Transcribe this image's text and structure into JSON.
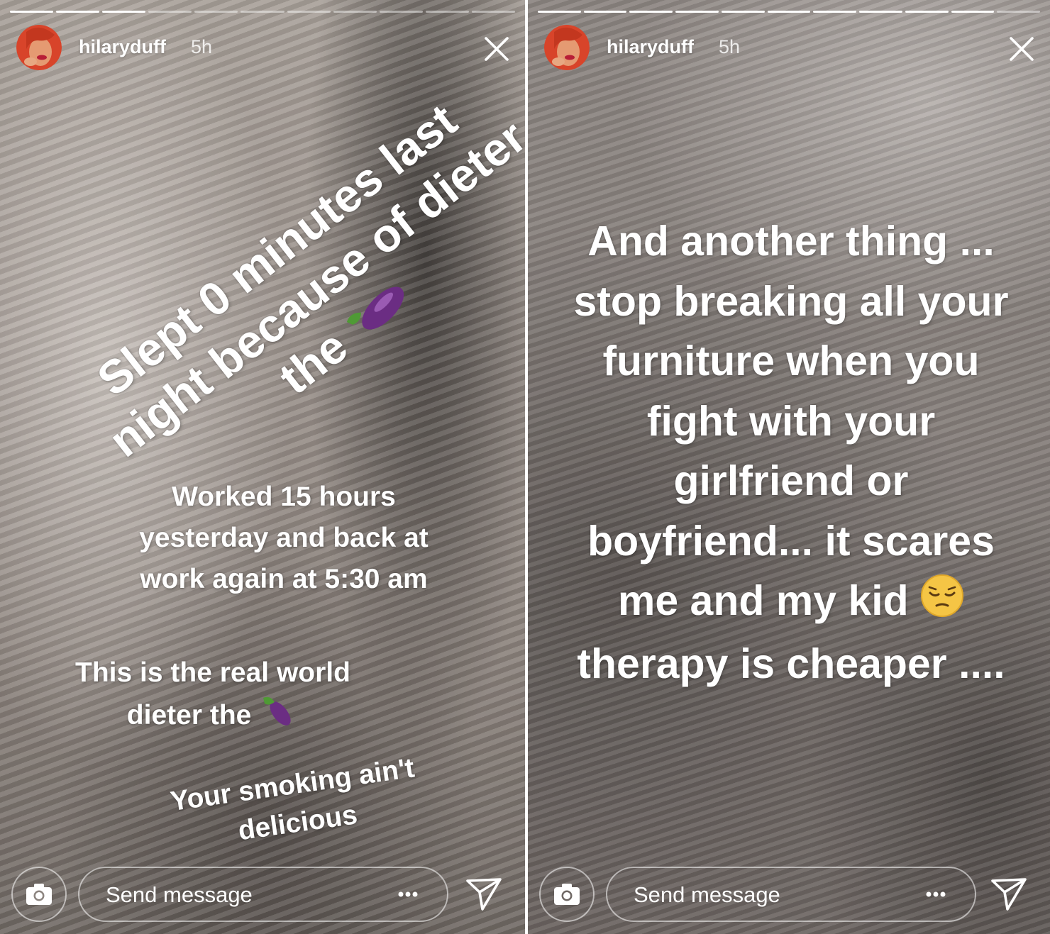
{
  "stories": [
    {
      "username": "hilaryduff",
      "time": "5h",
      "progress": {
        "total_segments": 11,
        "seen_segments": 3
      },
      "captions": [
        {
          "lines": [
            "Slept 0 minutes last",
            "night because of dieter",
            "the"
          ],
          "emoji": "eggplant"
        },
        {
          "lines": [
            "Worked 15 hours",
            "yesterday and back at",
            "work again at 5:30 am"
          ]
        },
        {
          "lines": [
            "This is the real world",
            "dieter the"
          ],
          "emoji": "eggplant"
        },
        {
          "lines": [
            "Your smoking ain't",
            "delicious"
          ]
        }
      ],
      "footer": {
        "message_placeholder": "Send message"
      }
    },
    {
      "username": "hilaryduff",
      "time": "5h",
      "progress": {
        "total_segments": 11,
        "seen_segments": 10
      },
      "captions": [
        {
          "lines": [
            "And another thing ...",
            "stop breaking all your",
            "furniture when you",
            "fight with your",
            "girlfriend or",
            "boyfriend... it scares",
            "me and my kid",
            "therapy is cheaper ...."
          ],
          "emoji": "pensive-face"
        }
      ],
      "footer": {
        "message_placeholder": "Send message"
      }
    }
  ],
  "icons": {
    "close": "close-icon",
    "camera": "camera-icon",
    "more": "more-icon",
    "send": "send-icon",
    "eggplant": "eggplant-emoji",
    "pensive": "pensive-face-emoji"
  },
  "colors": {
    "text": "#ffffff",
    "avatar_skin": "#e59a72",
    "avatar_hair": "#d8442a",
    "eggplant": "#6b2d83",
    "eggplant_stem": "#4f9a35",
    "pensive_face": "#f5c545"
  }
}
